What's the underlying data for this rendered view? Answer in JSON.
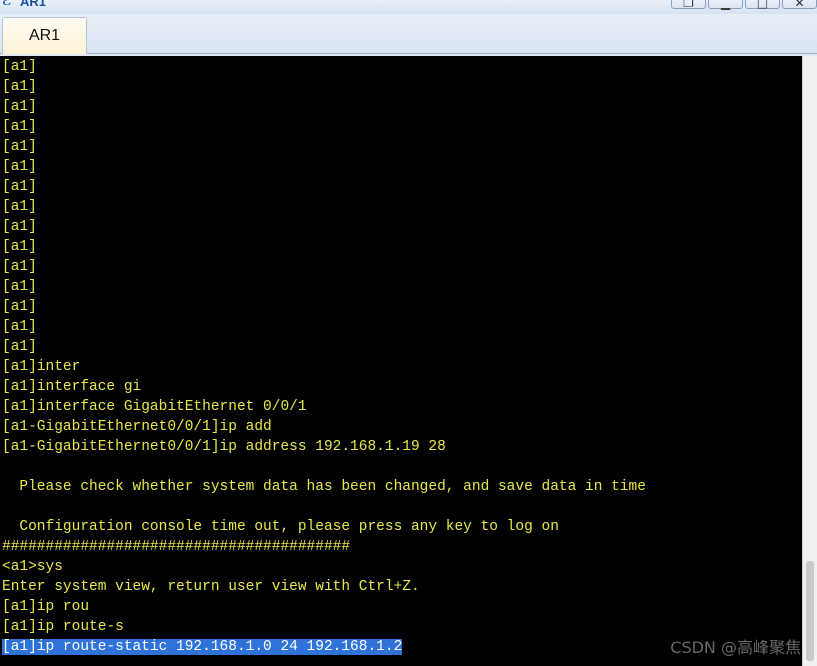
{
  "window": {
    "title": "AR1",
    "logo_icon": "app-logo-icon",
    "controls": {
      "restore": "restore-icon",
      "minimize": "minimize-icon",
      "maximize": "maximize-icon",
      "close": "close-icon"
    }
  },
  "tabs": [
    {
      "label": "AR1",
      "active": true
    }
  ],
  "terminal": {
    "text_color": "#e8e84a",
    "background": "#000000",
    "selection_color": "#2f73d9",
    "lines": [
      "[a1]",
      "[a1]",
      "[a1]",
      "[a1]",
      "[a1]",
      "[a1]",
      "[a1]",
      "[a1]",
      "[a1]",
      "[a1]",
      "[a1]",
      "[a1]",
      "[a1]",
      "[a1]",
      "[a1]",
      "[a1]inter",
      "[a1]interface gi",
      "[a1]interface GigabitEthernet 0/0/1",
      "[a1-GigabitEthernet0/0/1]ip add",
      "[a1-GigabitEthernet0/0/1]ip address 192.168.1.19 28",
      "",
      "  Please check whether system data has been changed, and save data in time",
      "",
      "  Configuration console time out, please press any key to log on",
      "########################################",
      "<a1>sys",
      "Enter system view, return user view with Ctrl+Z.",
      "[a1]ip rou",
      "[a1]ip route-s",
      "[a1]ip route-static 192.168.1.0 24 192.168.1.2"
    ],
    "selected_line_index": 29
  },
  "watermark": "CSDN @高峰聚焦"
}
